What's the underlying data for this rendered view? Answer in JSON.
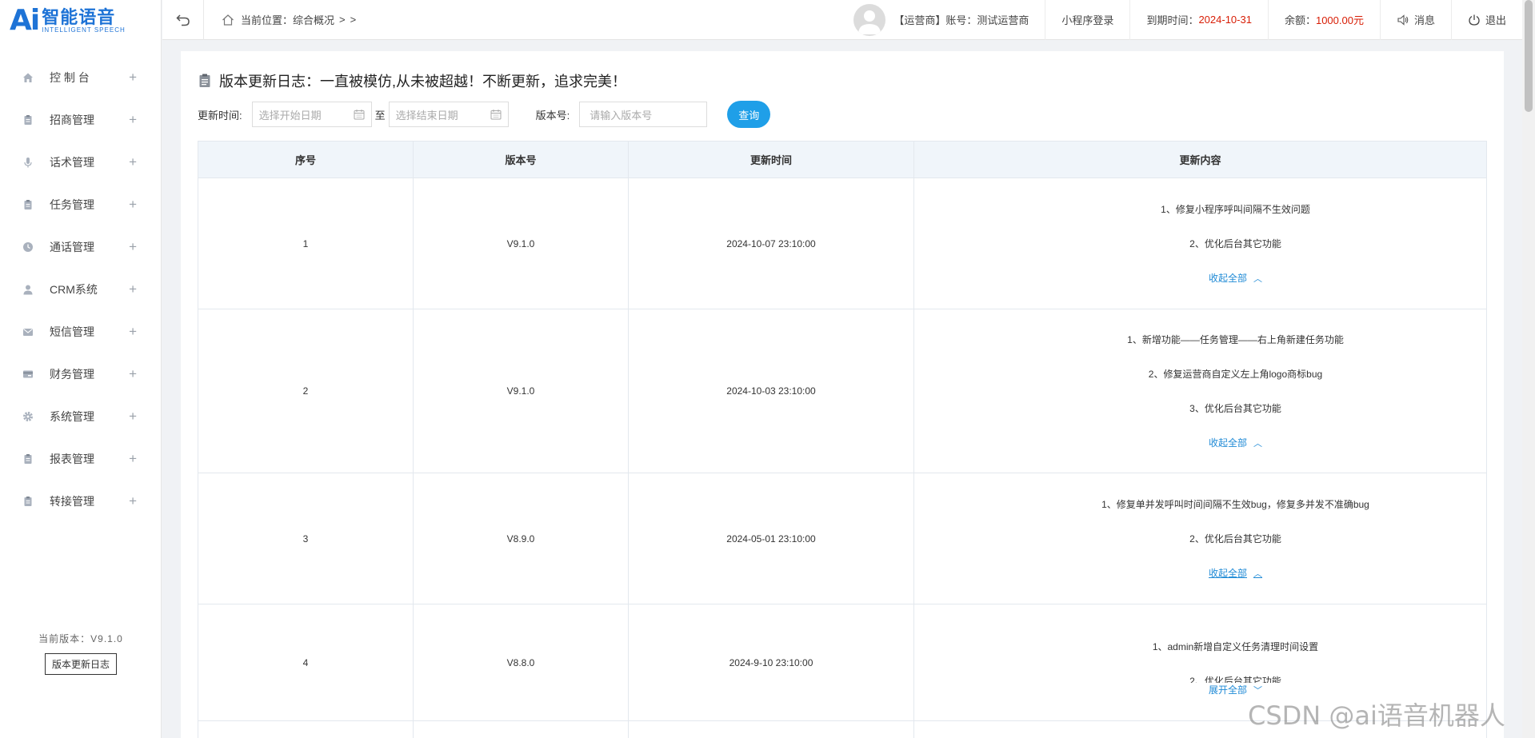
{
  "logo": {
    "mark": "Ai",
    "name": "智能语音",
    "subtitle": "INTELLIGENT SPEECH"
  },
  "sidebar": {
    "items": [
      {
        "label": "控 制 台",
        "icon": "home-icon"
      },
      {
        "label": "招商管理",
        "icon": "clipboard-icon"
      },
      {
        "label": "话术管理",
        "icon": "microphone-icon"
      },
      {
        "label": "任务管理",
        "icon": "clipboard-icon"
      },
      {
        "label": "通话管理",
        "icon": "clock-icon"
      },
      {
        "label": "CRM系统",
        "icon": "user-icon"
      },
      {
        "label": "短信管理",
        "icon": "mail-icon"
      },
      {
        "label": "财务管理",
        "icon": "card-icon"
      },
      {
        "label": "系统管理",
        "icon": "gear-icon"
      },
      {
        "label": "报表管理",
        "icon": "clipboard-icon"
      },
      {
        "label": "转接管理",
        "icon": "clipboard-icon"
      }
    ],
    "version_text": "当前版本：V9.1.0",
    "version_log_button": "版本更新日志"
  },
  "header": {
    "breadcrumb_prefix": "当前位置：",
    "breadcrumb_current": "综合概况",
    "breadcrumb_sep1": ">",
    "breadcrumb_sep2": ">",
    "account_label": "【运营商】账号：测试运营商",
    "mini_program_login": "小程序登录",
    "expire_label": "到期时间：",
    "expire_value": "2024-10-31",
    "balance_label": "余额：",
    "balance_value": "1000.00元",
    "messages": "消息",
    "logout": "退出"
  },
  "page": {
    "title": "版本更新日志：一直被模仿,从未被超越！不断更新，追求完美！",
    "filters": {
      "time_label": "更新时间:",
      "start_placeholder": "选择开始日期",
      "to": "至",
      "end_placeholder": "选择结束日期",
      "version_label": "版本号:",
      "version_placeholder": "请输入版本号",
      "query_button": "查询"
    },
    "table": {
      "headers": [
        "序号",
        "版本号",
        "更新时间",
        "更新内容"
      ],
      "rows": [
        {
          "index": "1",
          "version": "V9.1.0",
          "time": "2024-10-07 23:10:00",
          "lines": [
            "1、修复小程序呼叫间隔不生效问题",
            "2、优化后台其它功能"
          ],
          "toggle": "收起全部",
          "toggle_icon": "chevron-up"
        },
        {
          "index": "2",
          "version": "V9.1.0",
          "time": "2024-10-03 23:10:00",
          "lines": [
            "1、新增功能——任务管理——右上角新建任务功能",
            "2、修复运营商自定义左上角logo商标bug",
            "3、优化后台其它功能"
          ],
          "toggle": "收起全部",
          "toggle_icon": "chevron-up"
        },
        {
          "index": "3",
          "version": "V8.9.0",
          "time": "2024-05-01 23:10:00",
          "lines": [
            "1、修复单并发呼叫时间间隔不生效bug，修复多并发不准确bug",
            "2、优化后台其它功能"
          ],
          "toggle": "收起全部",
          "toggle_icon": "chevron-up"
        },
        {
          "index": "4",
          "version": "V8.8.0",
          "time": "2024-9-10 23:10:00",
          "lines": [
            "1、admin新增自定义任务清理时间设置",
            "2、优化后台其它功能"
          ],
          "toggle": "展开全部",
          "toggle_icon": "chevron-down"
        }
      ]
    }
  },
  "watermark": "CSDN @ai语音机器人",
  "colors": {
    "accent": "#1f9fe8",
    "link": "#1f8ad6",
    "brand": "#1e73d6",
    "alert": "#d81e06"
  }
}
